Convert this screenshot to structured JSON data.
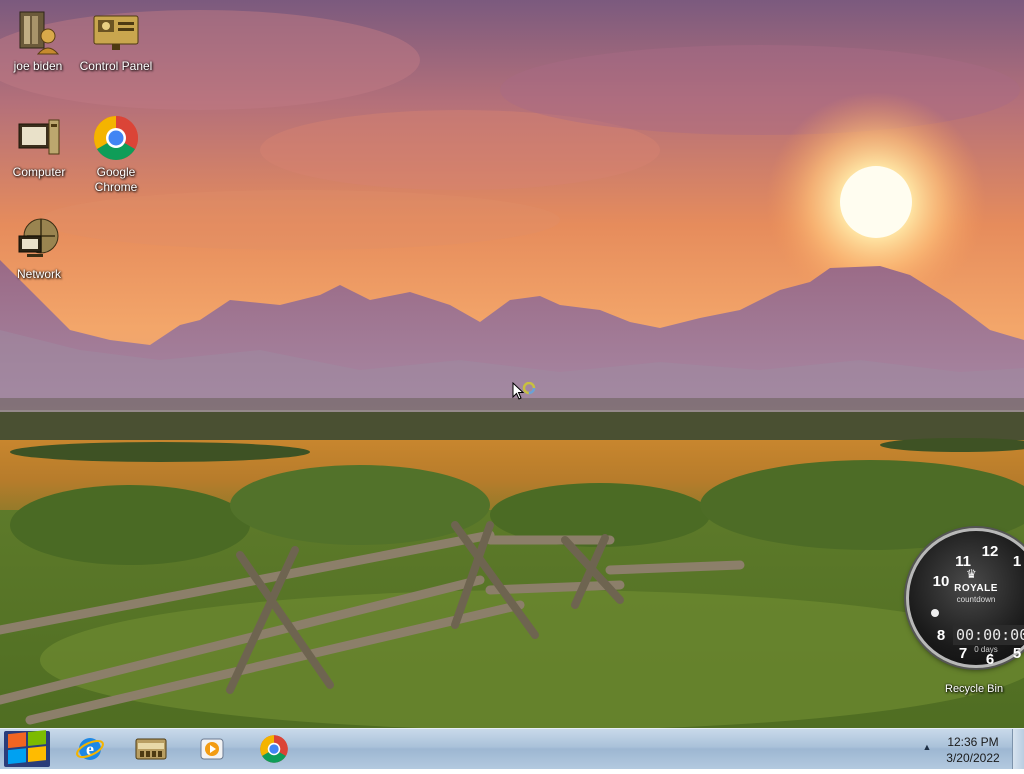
{
  "desktop": {
    "icons": [
      {
        "label": "joe biden",
        "icon": "user-folder-icon"
      },
      {
        "label": "Control Panel",
        "icon": "control-panel-icon"
      },
      {
        "label": "Computer",
        "icon": "computer-icon"
      },
      {
        "label": "Google Chrome",
        "icon": "chrome-icon"
      },
      {
        "label": "Network",
        "icon": "network-icon"
      }
    ],
    "recycle_bin_label": "Recycle Bin"
  },
  "gadget": {
    "brand": "ROYALE",
    "subtitle": "countdown",
    "time": "00:00:00",
    "days": "0 days",
    "numbers": [
      "12",
      "1",
      "11",
      "10",
      "8",
      "7",
      "6",
      "5"
    ]
  },
  "taskbar": {
    "pinned": [
      "internet-explorer-icon",
      "file-explorer-icon",
      "media-player-icon",
      "chrome-icon"
    ],
    "time": "12:36 PM",
    "date": "3/20/2022"
  }
}
